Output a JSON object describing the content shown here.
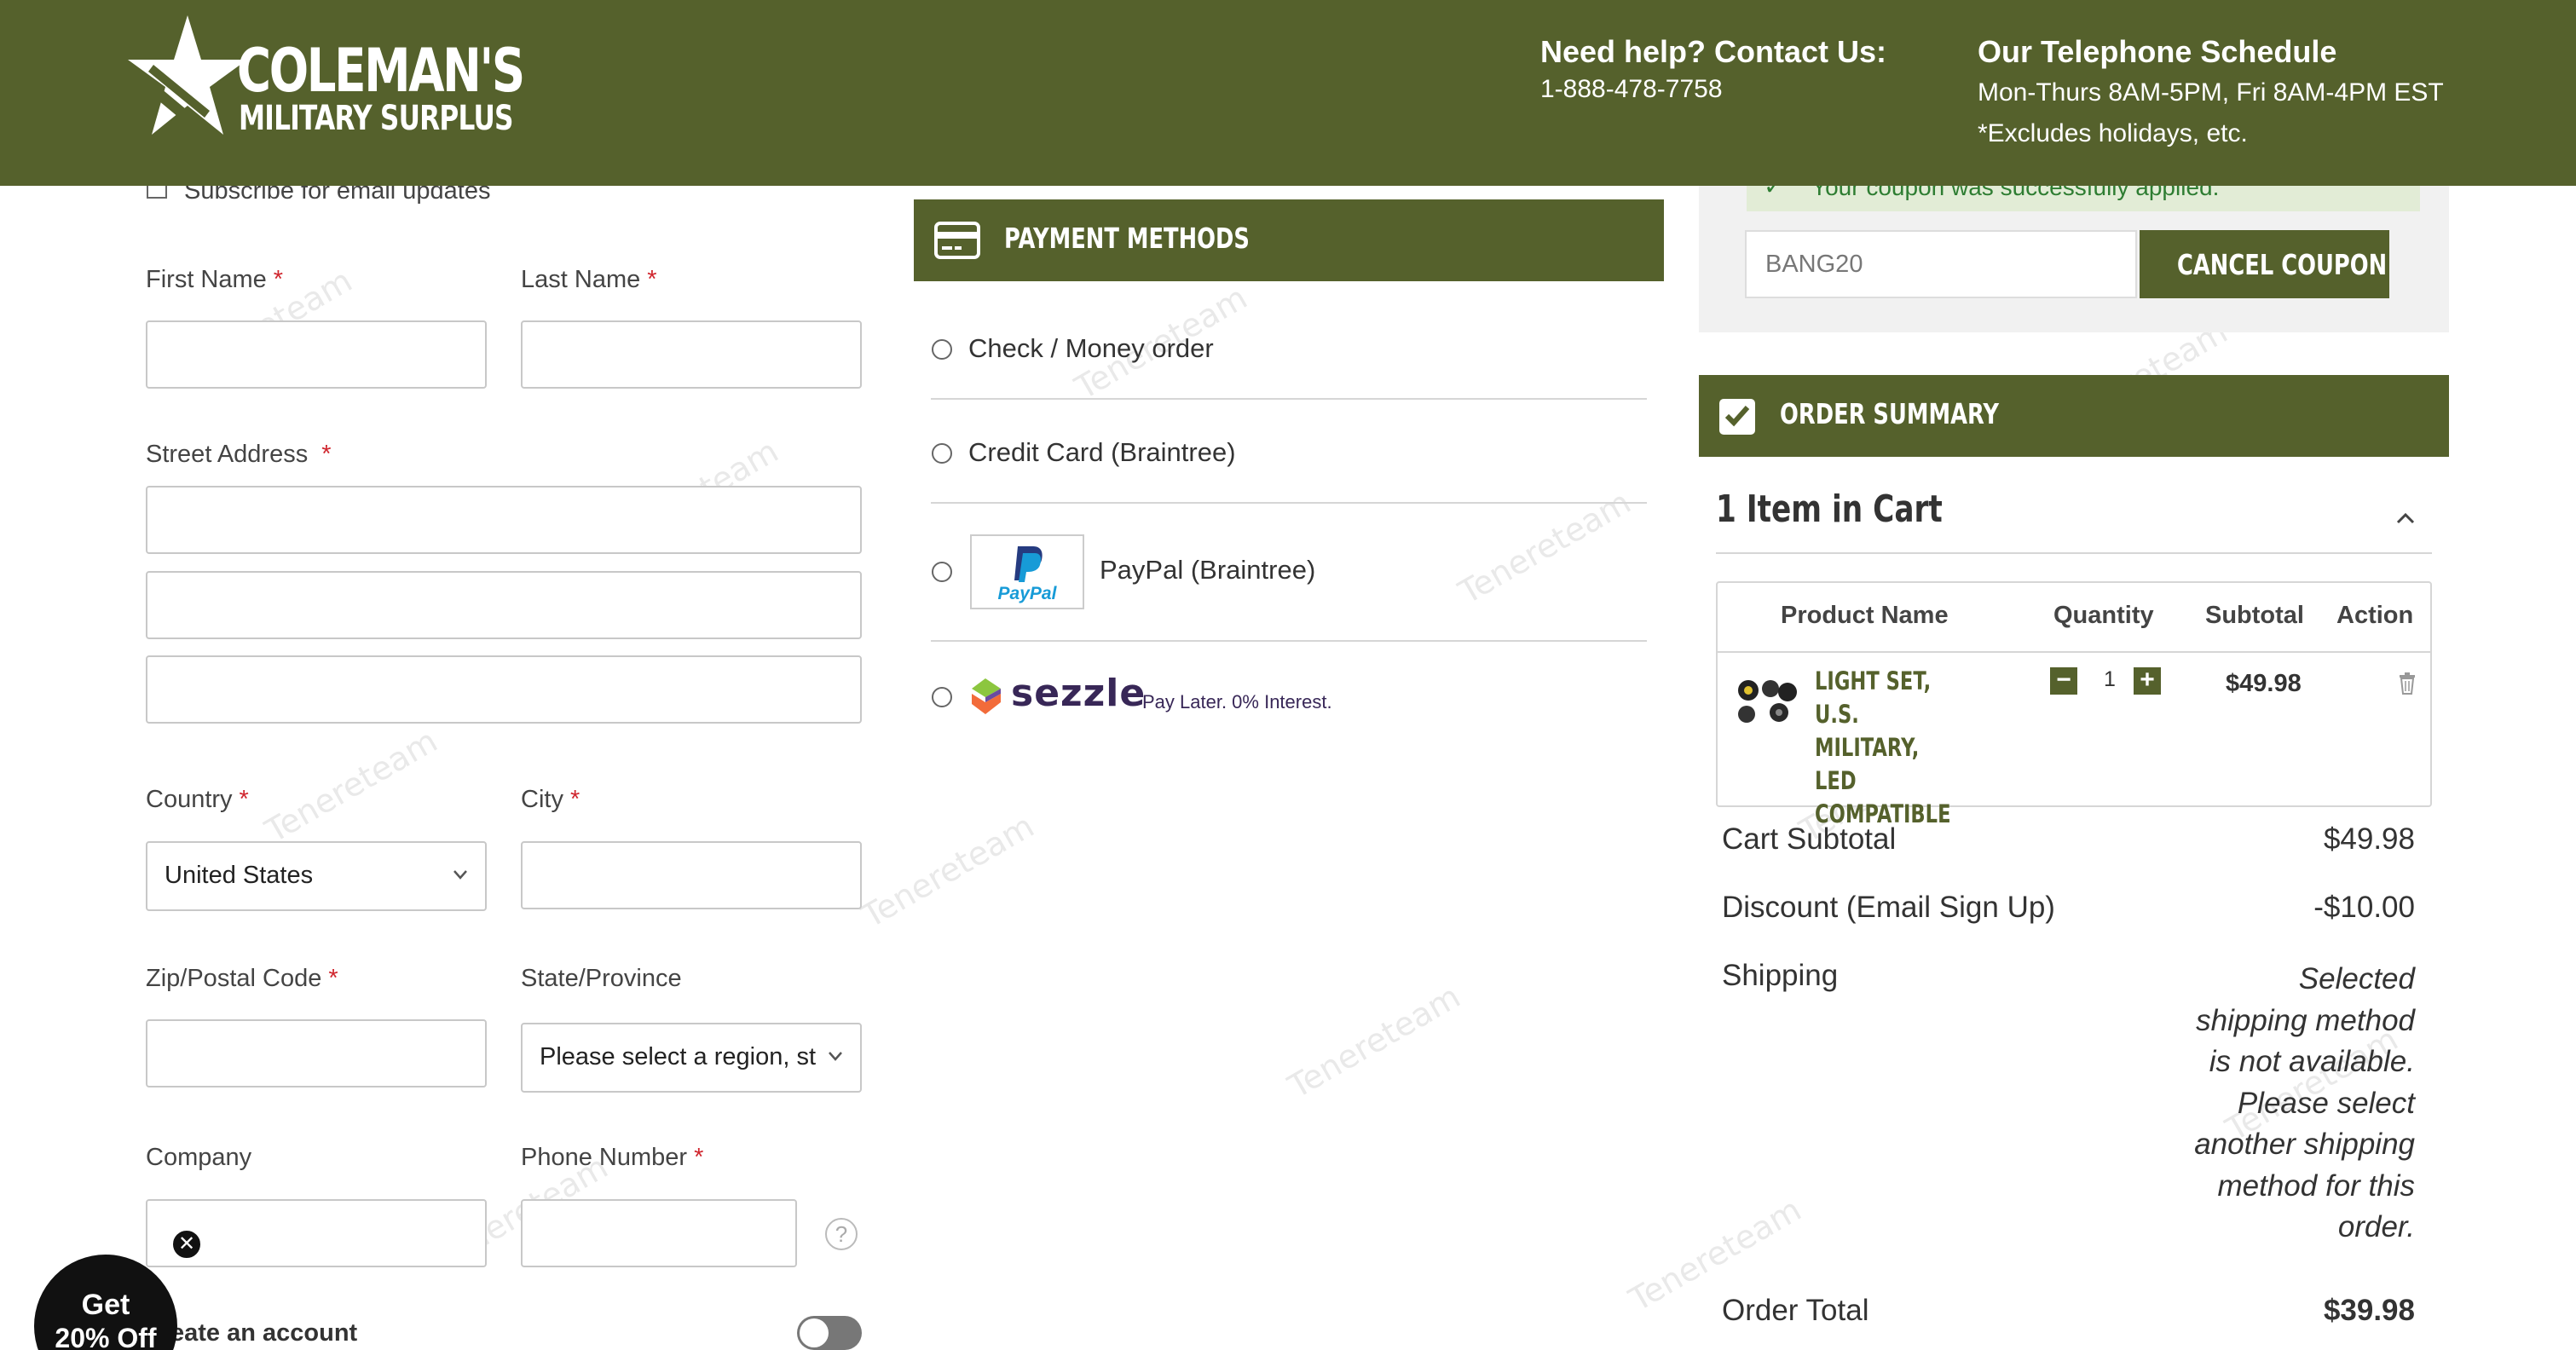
{
  "header": {
    "logo_line1": "COLEMAN'S",
    "logo_line2": "MILITARY SURPLUS",
    "help_title": "Need help? Contact Us:",
    "help_phone": "1-888-478-7758",
    "schedule_title": "Our Telephone Schedule",
    "schedule_hours": "Mon-Thurs 8AM-5PM, Fri 8AM-4PM EST",
    "schedule_note": "*Excludes holidays, etc."
  },
  "shipping_form": {
    "subscribe_label": "Subscribe for email updates",
    "first_name_label": "First Name",
    "last_name_label": "Last Name",
    "street_label": "Street Address",
    "country_label": "Country",
    "country_value": "United States",
    "city_label": "City",
    "zip_label": "Zip/Postal Code",
    "state_label": "State/Province",
    "state_value": "Please select a region, st",
    "company_label": "Company",
    "phone_label": "Phone Number",
    "help_glyph": "?",
    "create_account_label": "eate an account",
    "required_mark": "*"
  },
  "promo": {
    "line1": "Get",
    "line2": "20% Off",
    "close_glyph": "✕"
  },
  "payment": {
    "title": "PAYMENT METHODS",
    "methods": [
      {
        "label": "Check / Money order"
      },
      {
        "label": "Credit Card (Braintree)"
      },
      {
        "label": "PayPal (Braintree)",
        "logo_text": "PayPal"
      },
      {
        "label": "Pay Later. 0% Interest.",
        "logo_text": "sezzle"
      }
    ]
  },
  "coupon": {
    "success_message": "Your coupon was successfully applied.",
    "code_value": "BANG20",
    "cancel_label": "CANCEL COUPON"
  },
  "order_summary": {
    "title": "ORDER SUMMARY",
    "items_in_cart": "1 Item in Cart",
    "columns": [
      "Product Name",
      "Quantity",
      "Subtotal",
      "Action"
    ],
    "item": {
      "name_line1": "LIGHT SET, U.S.",
      "name_line2": "MILITARY, LED",
      "name_line3": "COMPATIBLE",
      "quantity": "1",
      "minus": "−",
      "plus": "+",
      "subtotal": "$49.98"
    },
    "cart_subtotal_label": "Cart Subtotal",
    "cart_subtotal_value": "$49.98",
    "discount_label": "Discount (Email Sign Up)",
    "discount_value": "-$10.00",
    "shipping_label": "Shipping",
    "shipping_lines": [
      "Selected",
      "shipping method",
      "is not available.",
      "Please select",
      "another shipping",
      "method for this",
      "order."
    ],
    "order_total_label": "Order Total",
    "order_total_value": "$39.98"
  },
  "colors": {
    "brand_green": "#55612c",
    "required_red": "#d0262e",
    "success_green": "#2e7d32"
  }
}
